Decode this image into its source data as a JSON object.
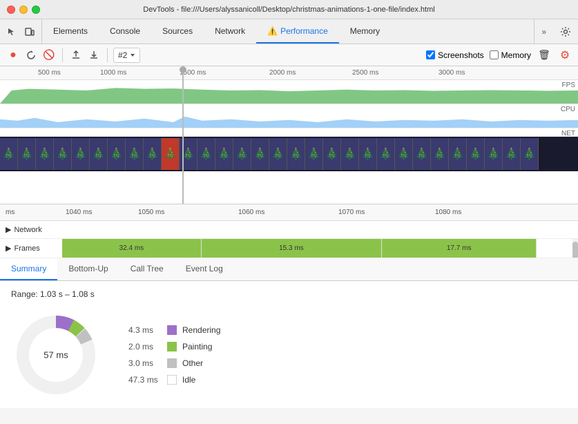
{
  "titlebar": {
    "title": "DevTools - file:///Users/alyssanicoll/Desktop/christmas-animations-1-one-file/index.html"
  },
  "nav": {
    "tabs": [
      {
        "label": "Elements",
        "active": false
      },
      {
        "label": "Console",
        "active": false
      },
      {
        "label": "Sources",
        "active": false
      },
      {
        "label": "Network",
        "active": false
      },
      {
        "label": "Performance",
        "active": true,
        "warning": true
      },
      {
        "label": "Memory",
        "active": false
      }
    ],
    "more_label": "»",
    "settings_label": "⚙"
  },
  "toolbar": {
    "record_label": "●",
    "reload_label": "↺",
    "clear_label": "🚫",
    "upload_label": "↑",
    "download_label": "↓",
    "recording_name": "#2",
    "screenshots_label": "Screenshots",
    "memory_label": "Memory",
    "delete_label": "🗑",
    "settings_label": "⚙"
  },
  "timeline": {
    "ruler_ticks": [
      "500 ms",
      "1000 ms",
      "1500 ms",
      "2000 ms",
      "2500 ms",
      "3000 ms"
    ],
    "ruler_tick_positions": [
      60,
      140,
      265,
      390,
      515,
      640
    ],
    "labels": {
      "fps": "FPS",
      "cpu": "CPU",
      "net": "NET"
    }
  },
  "detail": {
    "ruler_ticks": [
      "ms",
      "1040 ms",
      "1050 ms",
      "1060 ms",
      "1070 ms",
      "1080 ms"
    ],
    "ruler_tick_positions": [
      0,
      95,
      200,
      345,
      490,
      635
    ],
    "network_label": "Network",
    "frames_label": "Frames",
    "expand_icon": "▶",
    "frames": [
      {
        "label": "32.4 ms",
        "width_pct": 28,
        "color": "green"
      },
      {
        "label": "15.3 ms",
        "width_pct": 35,
        "color": "green"
      },
      {
        "label": "17.7 ms",
        "width_pct": 30,
        "color": "green"
      }
    ]
  },
  "analysis": {
    "tabs": [
      "Summary",
      "Bottom-Up",
      "Call Tree",
      "Event Log"
    ],
    "active_tab": "Summary",
    "range_text": "Range: 1.03 s – 1.08 s",
    "donut_center": "57 ms",
    "legend": [
      {
        "value": "4.3 ms",
        "label": "Rendering",
        "color": "#9c70c9"
      },
      {
        "value": "2.0 ms",
        "label": "Painting",
        "color": "#8bc34a"
      },
      {
        "value": "3.0 ms",
        "label": "Other",
        "color": "#c0c0c0"
      },
      {
        "value": "47.3 ms",
        "label": "Idle",
        "color": "#ffffff",
        "border": "#aaa"
      }
    ]
  }
}
